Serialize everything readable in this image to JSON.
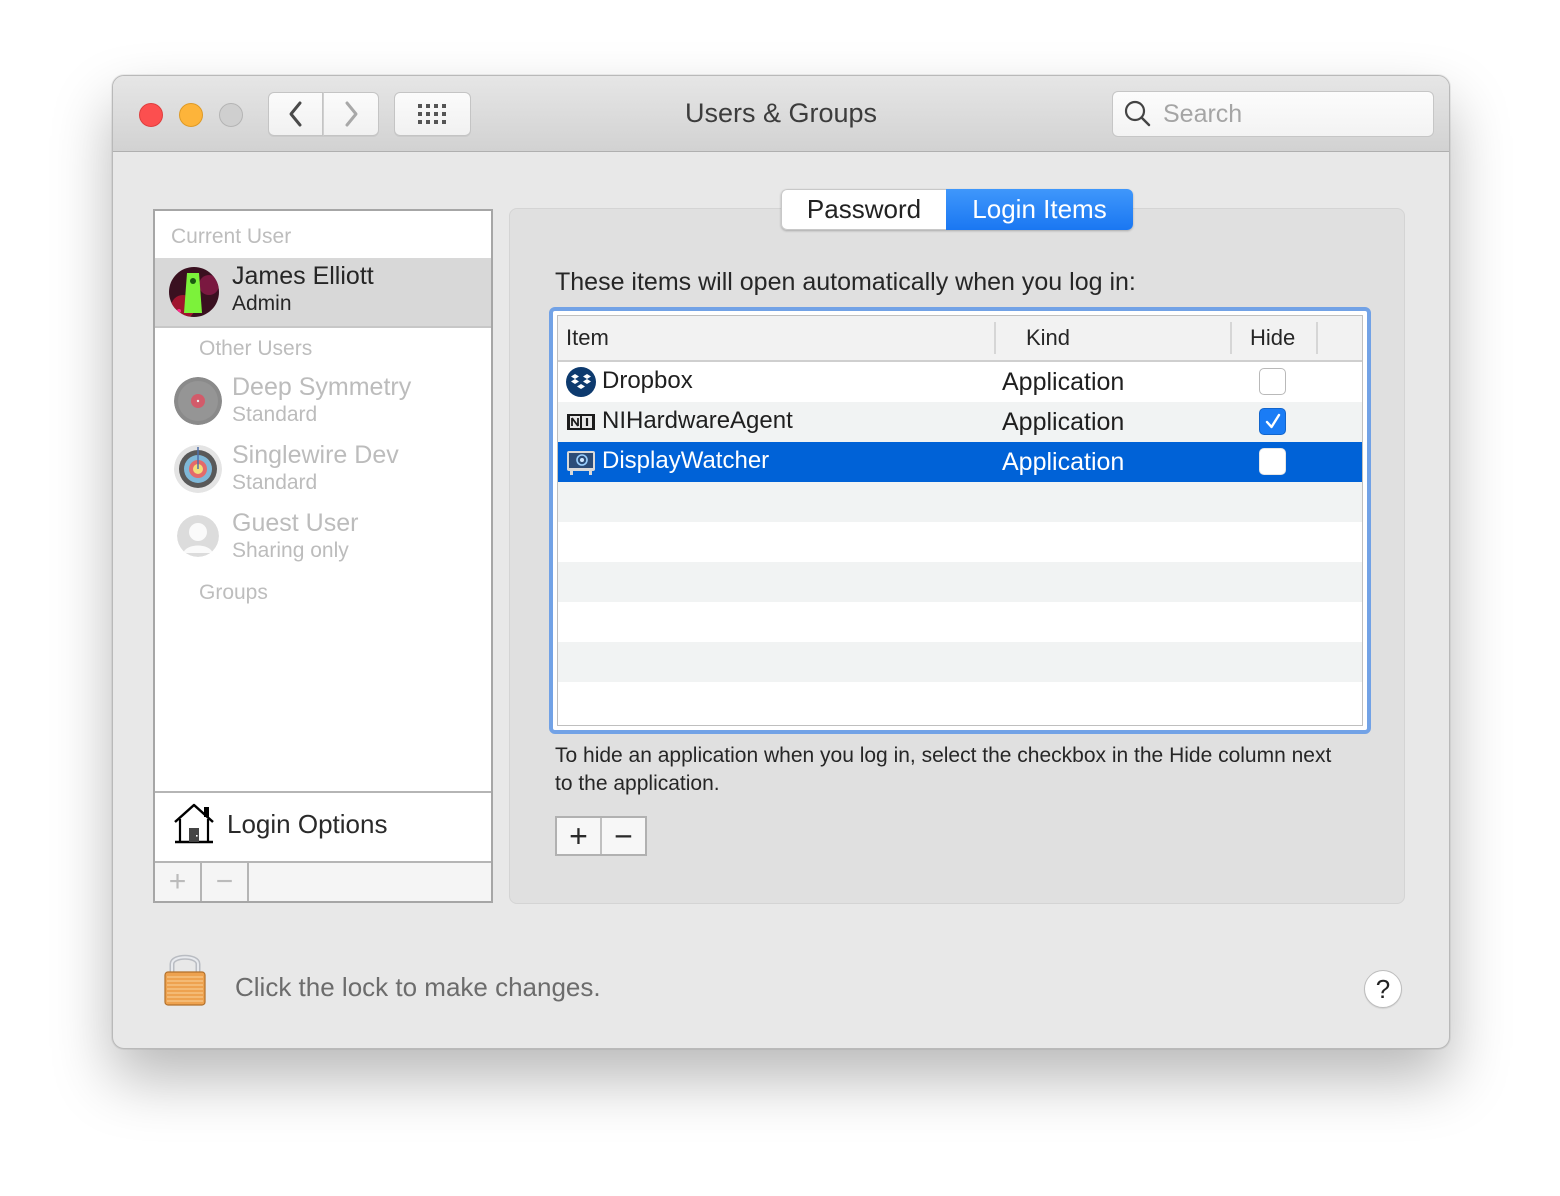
{
  "window": {
    "title": "Users & Groups",
    "search_placeholder": "Search",
    "traffic_lights": {
      "close": "#fc4f4f",
      "minimize": "#fdb43a",
      "zoom": "#cfcfcf"
    }
  },
  "sidebar": {
    "current_user_label": "Current User",
    "current_user": {
      "name": "James Elliott",
      "role": "Admin"
    },
    "other_users_label": "Other Users",
    "other_users": [
      {
        "name": "Deep Symmetry",
        "role": "Standard",
        "icon": "record-avatar"
      },
      {
        "name": "Singlewire Dev",
        "role": "Standard",
        "icon": "target-avatar"
      },
      {
        "name": "Guest User",
        "role": "Sharing only",
        "icon": "guest-avatar"
      }
    ],
    "groups_label": "Groups",
    "login_options_label": "Login Options",
    "add_label": "+",
    "remove_label": "−"
  },
  "tabs": [
    {
      "label": "Password",
      "selected": false
    },
    {
      "label": "Login Items",
      "selected": true
    }
  ],
  "login_items": {
    "intro": "These items will open automatically when you log in:",
    "columns": {
      "item": "Item",
      "kind": "Kind",
      "hide": "Hide"
    },
    "rows": [
      {
        "name": "Dropbox",
        "kind": "Application",
        "hide": false,
        "selected": false,
        "icon": "dropbox-icon"
      },
      {
        "name": "NIHardwareAgent",
        "kind": "Application",
        "hide": true,
        "selected": false,
        "icon": "ni-hardware-agent-icon"
      },
      {
        "name": "DisplayWatcher",
        "kind": "Application",
        "hide": false,
        "selected": true,
        "icon": "display-watcher-icon"
      }
    ],
    "help_text": "To hide an application when you log in, select the checkbox in the Hide column next to the application.",
    "add_label": "+",
    "remove_label": "−",
    "selection_color": "#0062d7",
    "focus_ring_color": "#72a2e6"
  },
  "footer": {
    "lock_text": "Click the lock to make changes.",
    "help_label": "?"
  }
}
